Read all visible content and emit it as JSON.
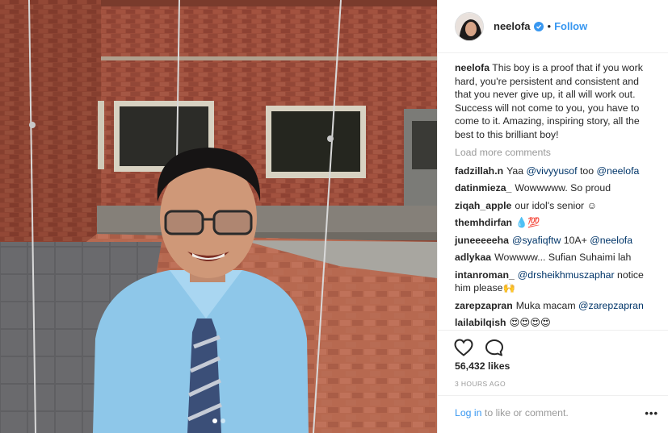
{
  "post": {
    "username": "neelofa",
    "follow_label": "Follow",
    "separator": "•",
    "caption": "This boy is a proof that if you work hard, you're persistent and consistent and that you never give up, it all will work out. Success will not come to you, you have to come to it. Amazing, inspiring story, all the best to this brilliant boy!",
    "load_more": "Load more comments",
    "likes": "56,432 likes",
    "time": "3 HOURS AGO",
    "login_link": "Log in",
    "login_rest": " to like or comment.",
    "more_label": "•••"
  },
  "comments": [
    {
      "user": "fadzillah.n",
      "parts": [
        {
          "t": "Yaa "
        },
        {
          "m": "@vivyyusof"
        },
        {
          "t": " too "
        },
        {
          "m": "@neelofa"
        }
      ]
    },
    {
      "user": "datinmieza_",
      "parts": [
        {
          "t": "Wowwwww. So proud"
        }
      ]
    },
    {
      "user": "ziqah_apple",
      "parts": [
        {
          "t": "our idol's senior ☺"
        }
      ]
    },
    {
      "user": "themhdirfan",
      "parts": [
        {
          "t": "💧💯"
        }
      ]
    },
    {
      "user": "juneeeeeha",
      "parts": [
        {
          "m": "@syafiqftw"
        },
        {
          "t": " 10A+ "
        },
        {
          "m": "@neelofa"
        }
      ]
    },
    {
      "user": "adlykaa",
      "parts": [
        {
          "t": "Wowwww... Sufian Suhaimi lah"
        }
      ]
    },
    {
      "user": "intanroman_",
      "parts": [
        {
          "m": "@drsheikhmuszaphar"
        },
        {
          "t": " notice him please🙌"
        }
      ]
    },
    {
      "user": "zarepzapran",
      "parts": [
        {
          "t": "Muka macam "
        },
        {
          "m": "@zarepzapran"
        }
      ]
    },
    {
      "user": "lailabilqish",
      "parts": [
        {
          "t": "😍😍😍😍"
        }
      ]
    }
  ],
  "icons": {
    "like": "heart-icon",
    "comment": "comment-icon",
    "verified": "verified-badge-icon"
  },
  "colors": {
    "link_blue": "#3897f0",
    "text": "#262626",
    "muted": "#999999",
    "mention": "#003569"
  }
}
